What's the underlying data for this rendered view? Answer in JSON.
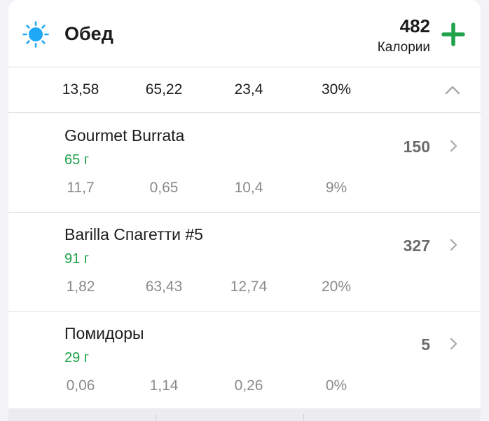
{
  "meal": {
    "title": "Обед",
    "calories_value": "482",
    "calories_label": "Калории",
    "icon": "sun-icon",
    "accent_color": "#1fa24a",
    "icon_color": "#1fa8f5"
  },
  "summary": {
    "values": [
      "13,58",
      "65,22",
      "23,4",
      "30%"
    ]
  },
  "foods": [
    {
      "name": "Gourmet Burrata",
      "weight": "65 г",
      "calories": "150",
      "values": [
        "11,7",
        "0,65",
        "10,4",
        "9%"
      ]
    },
    {
      "name": "Barilla Спагетти #5",
      "weight": "91 г",
      "calories": "327",
      "values": [
        "1,82",
        "63,43",
        "12,74",
        "20%"
      ]
    },
    {
      "name": "Помидоры",
      "weight": "29 г",
      "calories": "5",
      "values": [
        "0,06",
        "1,14",
        "0,26",
        "0%"
      ]
    }
  ]
}
